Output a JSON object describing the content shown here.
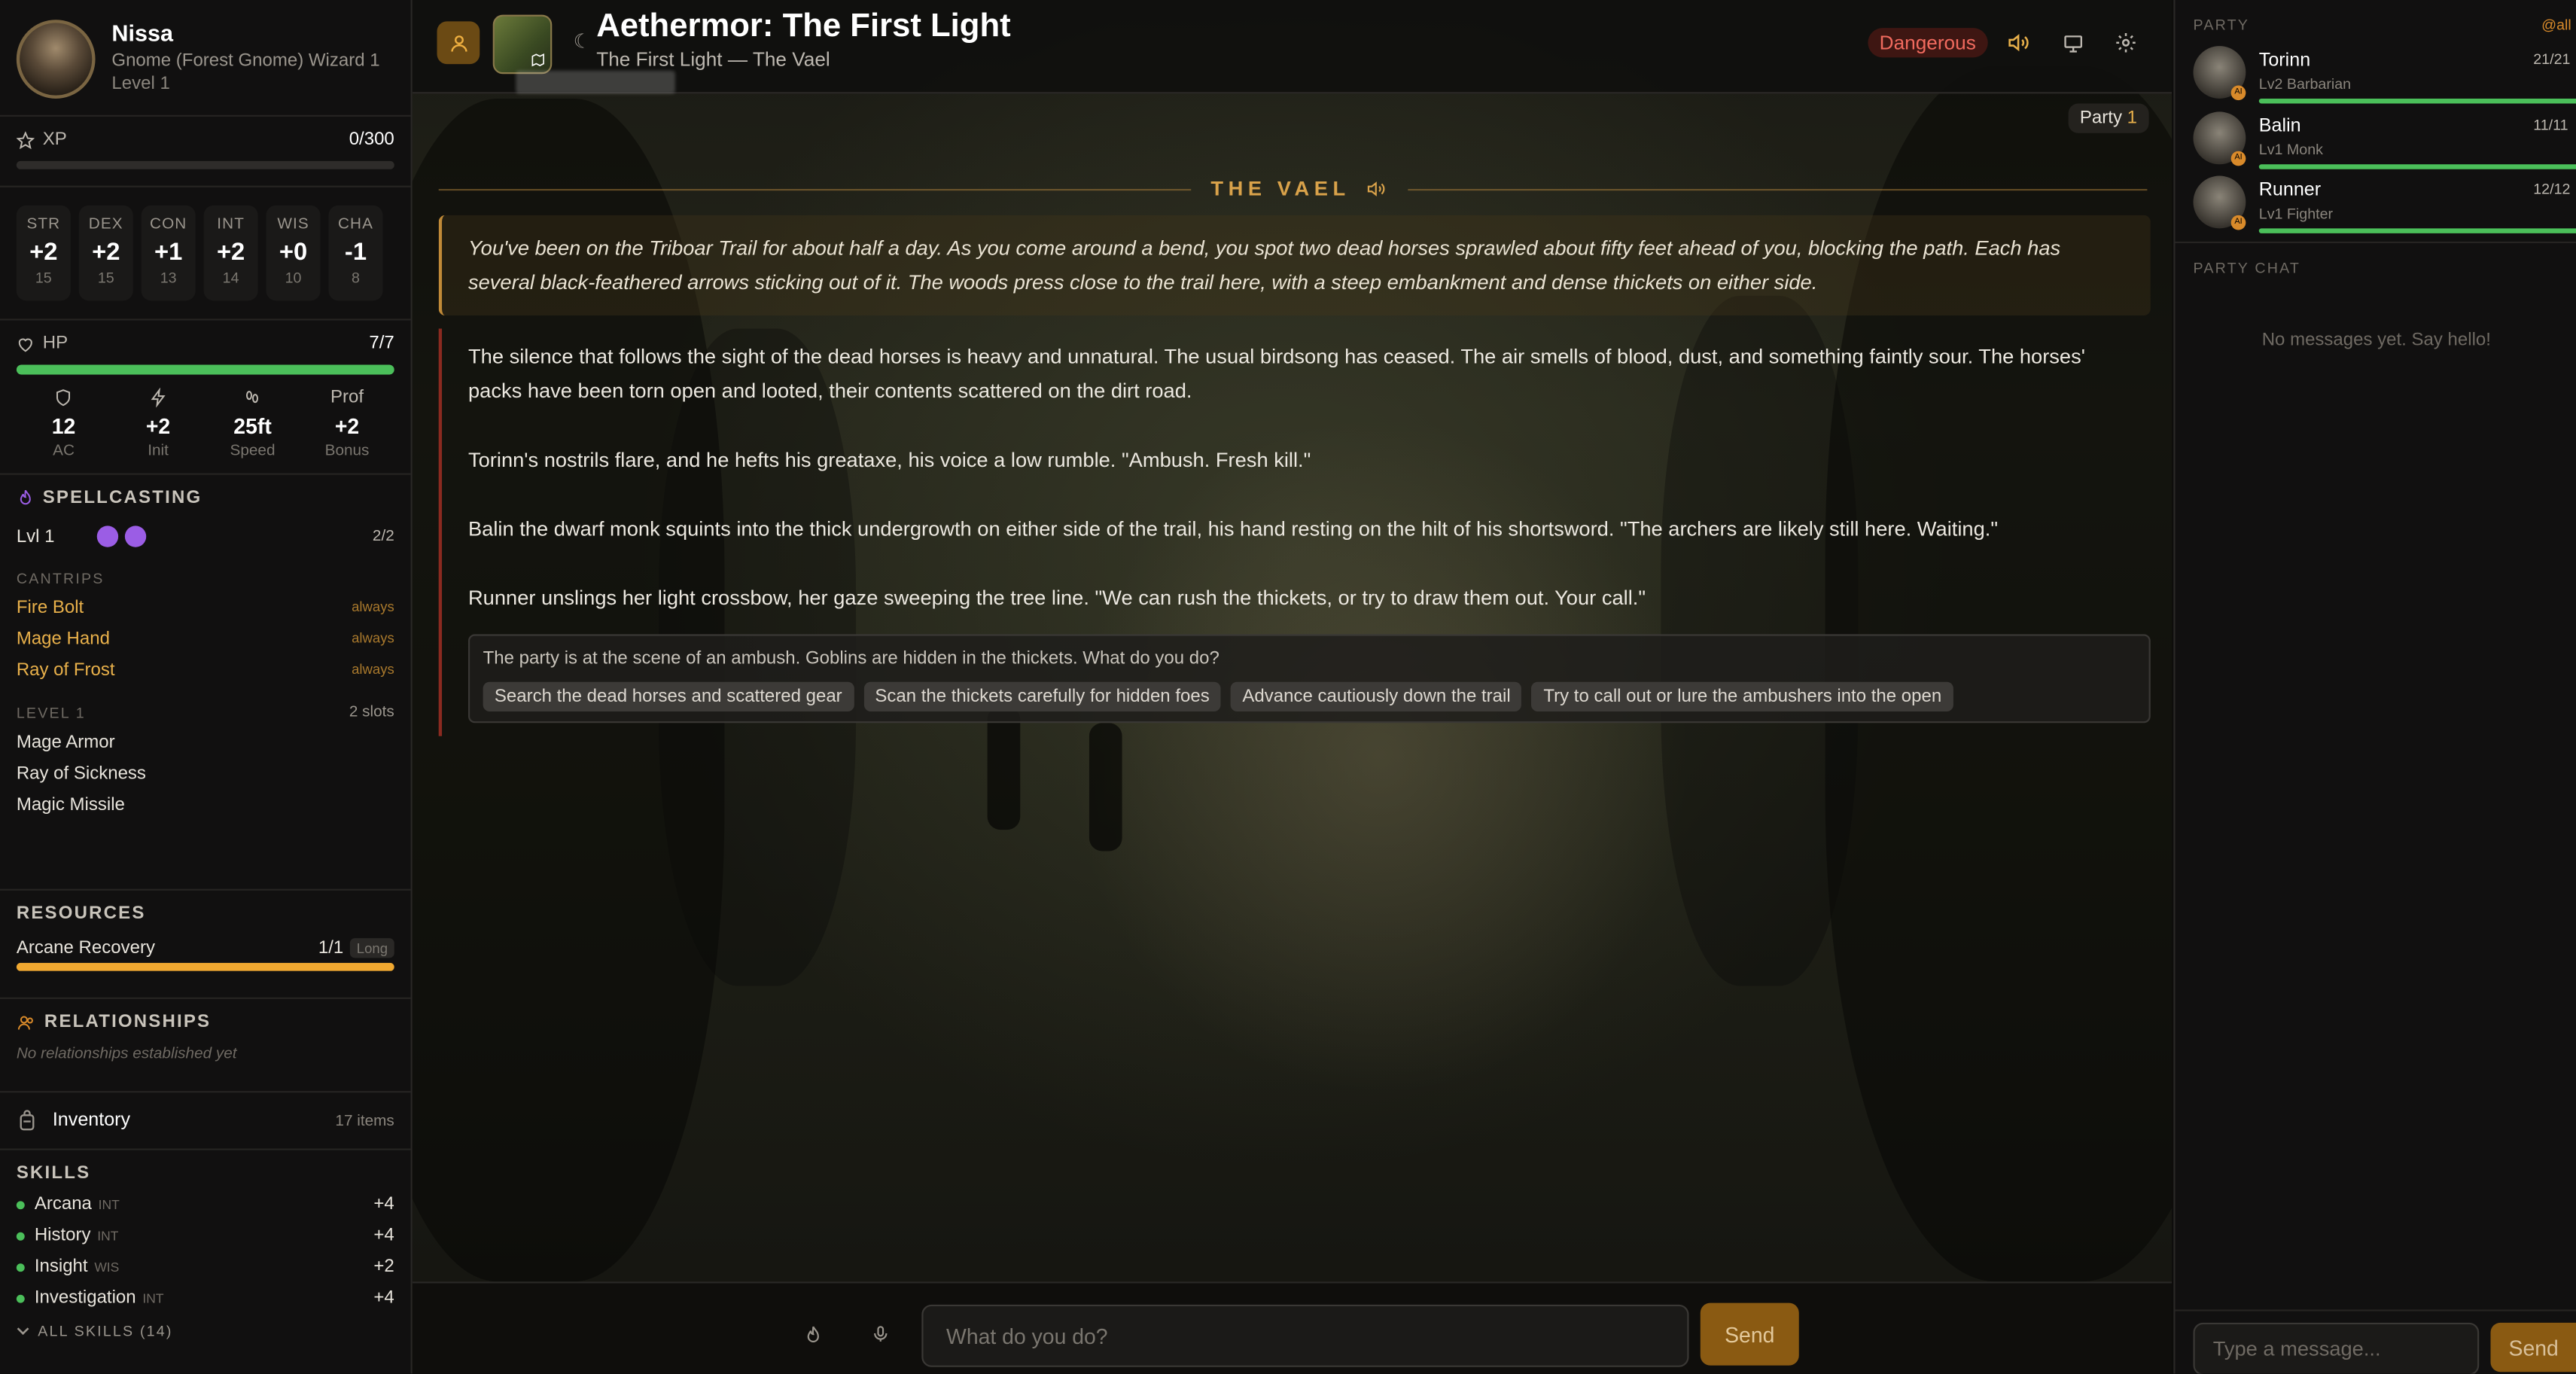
{
  "character": {
    "name": "Nissa",
    "race_class": "Gnome (Forest Gnome) Wizard 1",
    "level": "Level 1",
    "xp_label": "XP",
    "xp_value": "0/300",
    "xp_progress": 0,
    "abilities": [
      {
        "key": "STR",
        "mod": "+2",
        "score": "15"
      },
      {
        "key": "DEX",
        "mod": "+2",
        "score": "15"
      },
      {
        "key": "CON",
        "mod": "+1",
        "score": "13"
      },
      {
        "key": "INT",
        "mod": "+2",
        "score": "14"
      },
      {
        "key": "WIS",
        "mod": "+0",
        "score": "10"
      },
      {
        "key": "CHA",
        "mod": "-1",
        "score": "8"
      }
    ],
    "hp_label": "HP",
    "hp_value": "7/7",
    "hp_progress": 1.0,
    "combat": [
      {
        "value": "12",
        "label": "AC",
        "icon": "shield-icon"
      },
      {
        "value": "+2",
        "label": "Init",
        "icon": "lightning-icon"
      },
      {
        "value": "25ft",
        "label": "Speed",
        "icon": "footprints-icon"
      },
      {
        "value": "+2",
        "label": "Bonus",
        "header": "Prof"
      }
    ]
  },
  "spellcasting": {
    "title": "SPELLCASTING",
    "slot_level": "Lvl 1",
    "slots_used": "2/2",
    "cantrips_header": "CANTRIPS",
    "cantrips": [
      {
        "name": "Fire Bolt",
        "tag": "always"
      },
      {
        "name": "Mage Hand",
        "tag": "always"
      },
      {
        "name": "Ray of Frost",
        "tag": "always"
      }
    ],
    "level1_header": "LEVEL 1",
    "level1_slots": "2 slots",
    "level1_spells": [
      "Mage Armor",
      "Ray of Sickness",
      "Magic Missile"
    ]
  },
  "resources": {
    "title": "RESOURCES",
    "items": [
      {
        "name": "Arcane Recovery",
        "value": "1/1",
        "tag": "Long",
        "progress": 1.0
      }
    ]
  },
  "relationships": {
    "title": "RELATIONSHIPS",
    "empty": "No relationships established yet"
  },
  "inventory": {
    "label": "Inventory",
    "count": "17 items"
  },
  "skills": {
    "title": "SKILLS",
    "items": [
      {
        "name": "Arcana",
        "ability": "INT",
        "mod": "+4"
      },
      {
        "name": "History",
        "ability": "INT",
        "mod": "+4"
      },
      {
        "name": "Insight",
        "ability": "WIS",
        "mod": "+2"
      },
      {
        "name": "Investigation",
        "ability": "INT",
        "mod": "+4"
      }
    ],
    "all_label": "ALL SKILLS (14)"
  },
  "header": {
    "title": "Aethermor: The First Light",
    "subtitle": "The First Light — The Vael",
    "danger": "Dangerous",
    "party_label": "Party",
    "party_count": "1"
  },
  "scene": {
    "location": "THE VAEL",
    "intro": "You've been on the Triboar Trail for about half a day. As you come around a bend, you spot two dead horses sprawled about fifty feet ahead of you, blocking the path. Each has several black-feathered arrows sticking out of it. The woods press close to the trail here, with a steep embankment and dense thickets on either side.",
    "paragraphs": [
      "The silence that follows the sight of the dead horses is heavy and unnatural. The usual birdsong has ceased. The air smells of blood, dust, and something faintly sour. The horses' packs have been torn open and looted, their contents scattered on the dirt road.",
      "Torinn's nostrils flare, and he hefts his greataxe, his voice a low rumble. \"Ambush. Fresh kill.\"",
      "Balin the dwarf monk squints into the thick undergrowth on either side of the trail, his hand resting on the hilt of his shortsword. \"The archers are likely still here. Waiting.\"",
      "Runner unslings her light crossbow, her gaze sweeping the tree line. \"We can rush the thickets, or try to draw them out. Your call.\""
    ],
    "prompt": "The party is at the scene of an ambush. Goblins are hidden in the thickets. What do you do?",
    "choices": [
      "Search the dead horses and scattered gear",
      "Scan the thickets carefully for hidden foes",
      "Advance cautiously down the trail",
      "Try to call out or lure the ambushers into the open"
    ]
  },
  "composer": {
    "placeholder": "What do you do?",
    "send": "Send"
  },
  "party": {
    "title": "PARTY",
    "mention": "@all",
    "members": [
      {
        "name": "Torinn",
        "class": "Lv2 Barbarian",
        "hp": "21/21",
        "hp_progress": 1.0
      },
      {
        "name": "Balin",
        "class": "Lv1 Monk",
        "hp": "11/11",
        "hp_progress": 1.0
      },
      {
        "name": "Runner",
        "class": "Lv1 Fighter",
        "hp": "12/12",
        "hp_progress": 1.0
      }
    ],
    "ai_badge": "AI"
  },
  "chat": {
    "title": "PARTY CHAT",
    "empty": "No messages yet. Say hello!",
    "placeholder": "Type a message...",
    "send": "Send"
  },
  "colors": {
    "accent": "#e8b04a",
    "hp_green": "#4bbf5a",
    "danger": "#f06a5e",
    "spell_slot": "#9b5de5",
    "resource_bar": "#f0a830"
  }
}
